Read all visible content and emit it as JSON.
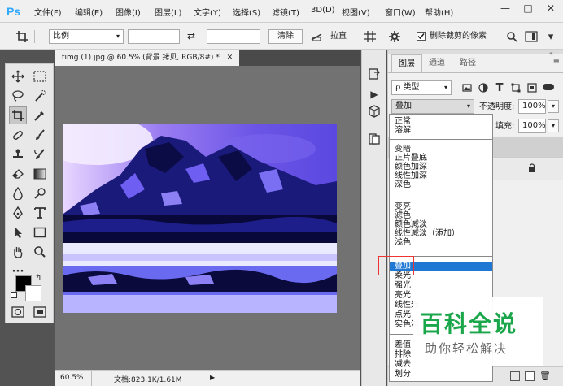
{
  "app": {
    "logo": "Ps"
  },
  "menu": [
    "文件(F)",
    "编辑(E)",
    "图像(I)",
    "图层(L)",
    "文字(Y)",
    "选择(S)",
    "滤镜(T)",
    "3D(D)",
    "视图(V)",
    "窗口(W)",
    "帮助(H)"
  ],
  "window_controls": {
    "minimize": "—",
    "maximize": "□",
    "close": "✕"
  },
  "options": {
    "ratio_label": "比例",
    "swap_icon": "⇄",
    "clear_label": "清除",
    "straighten_label": "拉直",
    "delete_cropped_label": "删除裁剪的像素",
    "delete_cropped_checked": true
  },
  "document": {
    "tab_title": "timg (1).jpg @ 60.5% (背景 拷贝, RGB/8#) *",
    "tab_close": "✕",
    "zoom": "60.5%",
    "doc_info": "文档:823.1K/1.61M",
    "status_arrow": "▶"
  },
  "panel": {
    "tabs": [
      "图层",
      "通道",
      "路径"
    ],
    "active_tab": 0,
    "filter_label": "ρ 类型",
    "blend_mode": "叠加",
    "opacity_label": "不透明度:",
    "opacity_value": "100%",
    "fill_label": "填充:",
    "fill_value": "100%"
  },
  "blend_modes": [
    [
      "正常",
      "溶解"
    ],
    [
      "变暗",
      "正片叠底",
      "颜色加深",
      "线性加深",
      "深色"
    ],
    [
      "变亮",
      "滤色",
      "颜色减淡",
      "线性减淡（添加）",
      "浅色"
    ],
    [
      "叠加",
      "柔光",
      "强光",
      "亮光",
      "线性光",
      "点光",
      "实色混合"
    ],
    [
      "差值",
      "排除",
      "减去",
      "划分"
    ]
  ],
  "selected_blend_mode": "叠加",
  "watermark": {
    "title": "百科全说",
    "subtitle": "助你轻松解决"
  },
  "colors": {
    "accent": "#1e78d4",
    "photoshop_blue": "#31a8ff",
    "watermark_green": "#1aa64a",
    "highlight_red": "#ee3333"
  }
}
